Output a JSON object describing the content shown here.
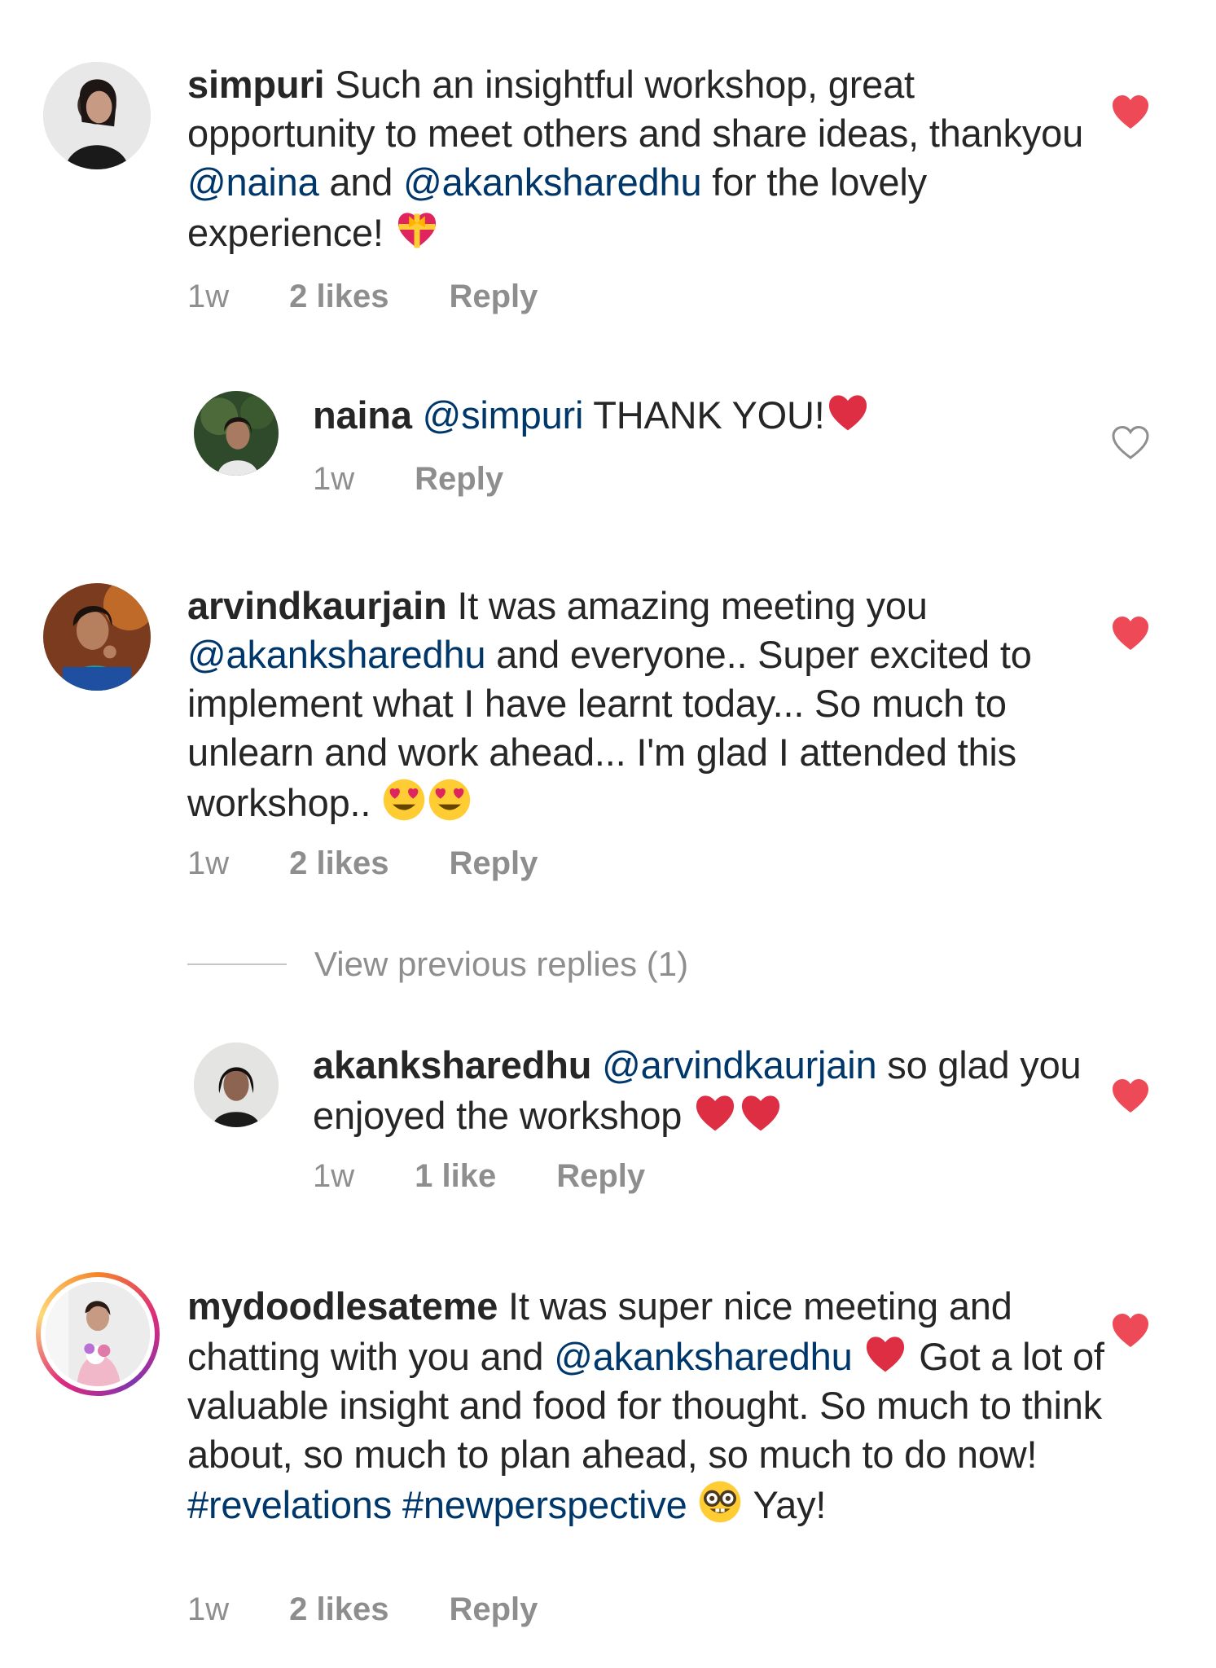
{
  "colors": {
    "text": "#262626",
    "muted": "#8e8e8e",
    "mention": "#00376b",
    "liked_heart": "#ed4956"
  },
  "view_previous_replies": "View previous replies (1)",
  "comments": [
    {
      "username": "simpuri",
      "avatar": "avatar-simpuri",
      "text_parts": [
        "Such an insightful workshop, great opportunity to meet others and share ideas, thankyou ",
        "@naina",
        " and ",
        "@akanksharedhu",
        " for the lovely experience! "
      ],
      "emoji": "heart-with-ribbon-emoji",
      "time": "1w",
      "likes": "2 likes",
      "reply": "Reply",
      "liked": true
    },
    {
      "username": "naina",
      "avatar": "avatar-naina",
      "text_parts": [
        "@simpuri",
        " THANK YOU!"
      ],
      "emoji": "red-heart-emoji",
      "time": "1w",
      "likes": "",
      "reply": "Reply",
      "liked": false
    },
    {
      "username": "arvindkaurjain",
      "avatar": "avatar-arvindkaurjain",
      "text_parts": [
        "It was amazing meeting you ",
        "@akanksharedhu",
        " and everyone.. Super excited to implement what I have learnt today... So much to unlearn and work ahead... I'm glad I attended this workshop.. "
      ],
      "emoji": "heart-eyes-emoji x2",
      "time": "1w",
      "likes": "2 likes",
      "reply": "Reply",
      "liked": true
    },
    {
      "username": "akanksharedhu",
      "avatar": "avatar-akanksharedhu",
      "text_parts": [
        "@arvindkaurjain",
        " so glad you enjoyed the workshop "
      ],
      "emoji": "red-heart-emoji x2",
      "time": "1w",
      "likes": "1 like",
      "reply": "Reply",
      "liked": true
    },
    {
      "username": "mydoodlesateme",
      "avatar": "avatar-mydoodlesateme",
      "text_parts": [
        "It was super nice meeting and chatting with you and ",
        "@akanksharedhu",
        " ",
        " Got a lot of valuable insight and food for thought. So much to think about, so much to plan ahead, so much to do now! ",
        "#revelations",
        " ",
        "#newperspective",
        " ",
        " Yay!"
      ],
      "emoji": "red-heart-emoji, nerd-face-emoji",
      "time": "1w",
      "likes": "2 likes",
      "reply": "Reply",
      "liked": true
    }
  ]
}
